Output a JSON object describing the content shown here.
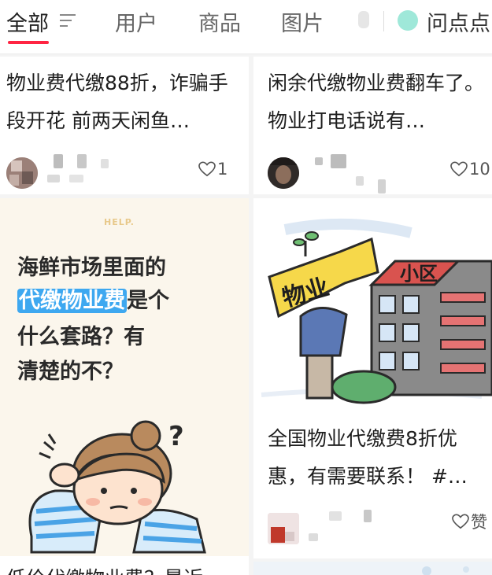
{
  "tabs": {
    "all": "全部",
    "users": "用户",
    "goods": "商品",
    "images": "图片",
    "ask": "问点点"
  },
  "colors": {
    "accent": "#ff2442",
    "highlight": "#3ea8f0",
    "ask_dot": "#9fe8d9"
  },
  "notes": [
    {
      "title": "物业费代缴88折，诈骗手段开花 前两天闲鱼…",
      "likes": "1",
      "icon": "heart-outline-icon"
    },
    {
      "title": "闲余代缴物业费翻车了。物业打电话说有…",
      "likes": "10",
      "icon": "heart-outline-icon"
    },
    {
      "cover": {
        "help": "HELP.",
        "line1": "海鲜市场里面的",
        "line2_highlight": "代缴物业费",
        "line2_rest": "是个",
        "line3": "什么套路？有",
        "line4": "清楚的不？"
      },
      "title": "低价代缴物业费？最近"
    },
    {
      "cover": {
        "sign_text": "物业",
        "building_text": "小区"
      },
      "title": "全国物业代缴费8折优惠，有需要联系！ #…",
      "likes": "赞",
      "icon": "heart-outline-icon"
    }
  ]
}
